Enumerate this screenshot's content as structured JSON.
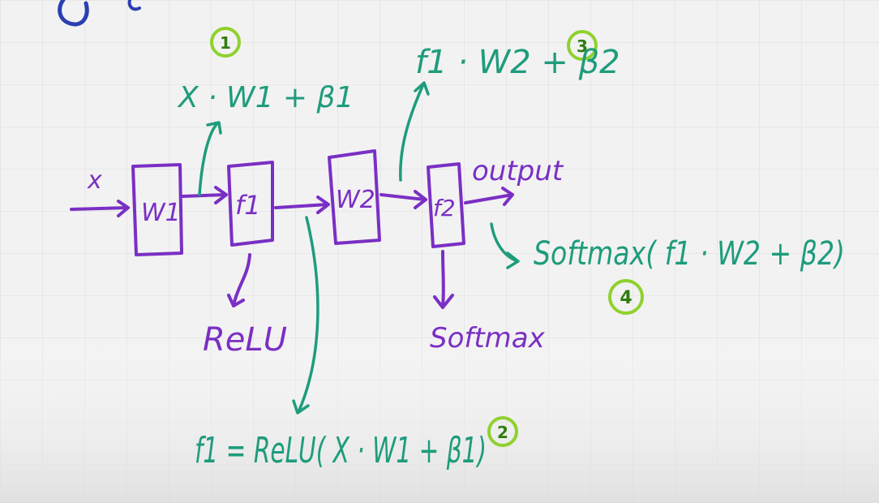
{
  "colors": {
    "ink_purple": "#7a2fc4",
    "ink_green": "#1e9c7c",
    "ink_blue": "#2b3fb3",
    "badge_green": "#8fd12e",
    "grid": "#dcdcdc",
    "background": "#f2f2f2"
  },
  "nodes": {
    "input": "x",
    "w1": "W1",
    "f1": "f1",
    "w2": "W2",
    "f2": "f2",
    "output": "output"
  },
  "activations": {
    "f1_activation": "ReLU",
    "f2_activation": "Softmax"
  },
  "steps": [
    {
      "number": "1",
      "formula": "X · W1 + β1"
    },
    {
      "number": "2",
      "formula": "f1 = ReLU( X · W1 + β1)"
    },
    {
      "number": "3",
      "formula": "f1 · W2 + β2"
    },
    {
      "number": "4",
      "formula": "Softmax( f1 · W2 + β2)"
    }
  ]
}
